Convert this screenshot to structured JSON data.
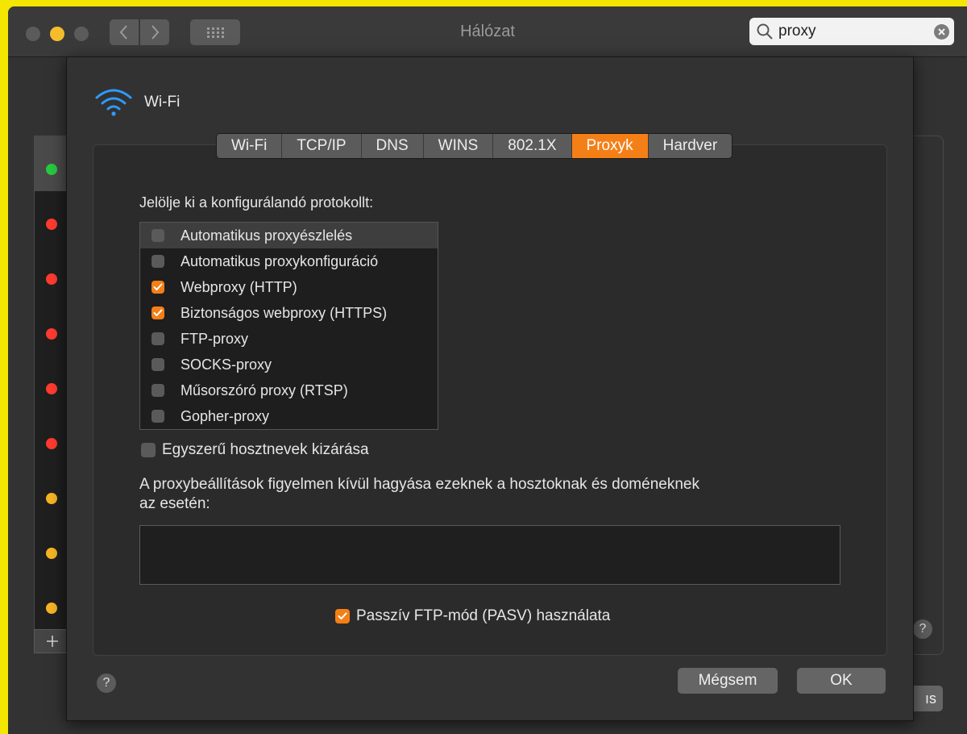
{
  "window": {
    "title": "Hálózat"
  },
  "search": {
    "value": "proxy"
  },
  "sheet": {
    "interface_name": "Wi-Fi",
    "tabs": [
      {
        "label": "Wi-Fi",
        "active": false
      },
      {
        "label": "TCP/IP",
        "active": false
      },
      {
        "label": "DNS",
        "active": false
      },
      {
        "label": "WINS",
        "active": false
      },
      {
        "label": "802.1X",
        "active": false
      },
      {
        "label": "Proxyk",
        "active": true
      },
      {
        "label": "Hardver",
        "active": false
      }
    ],
    "protocols_label": "Jelölje ki a konfigurálandó protokollt:",
    "protocols": [
      {
        "label": "Automatikus proxyészlelés",
        "checked": false,
        "selected": true
      },
      {
        "label": "Automatikus proxykonfiguráció",
        "checked": false,
        "selected": false
      },
      {
        "label": "Webproxy (HTTP)",
        "checked": true,
        "selected": false
      },
      {
        "label": "Biztonságos webproxy (HTTPS)",
        "checked": true,
        "selected": false
      },
      {
        "label": "FTP-proxy",
        "checked": false,
        "selected": false
      },
      {
        "label": "SOCKS-proxy",
        "checked": false,
        "selected": false
      },
      {
        "label": "Műsorszóró proxy (RTSP)",
        "checked": false,
        "selected": false
      },
      {
        "label": "Gopher-proxy",
        "checked": false,
        "selected": false
      }
    ],
    "exclude_simple_hosts": {
      "label": "Egyszerű hosztnevek kizárása",
      "checked": false
    },
    "bypass_label_line1": "A proxybeállítások figyelmen kívül hagyása ezeknek a hosztoknak és doméneknek",
    "bypass_label_line2": "az esetén:",
    "bypass_value": "",
    "pasv": {
      "label": "Passzív FTP-mód (PASV) használata",
      "checked": true
    },
    "cancel_label": "Mégsem",
    "ok_label": "OK",
    "help_label": "?"
  },
  "background": {
    "status_dots": [
      "green",
      "red",
      "red",
      "red",
      "red",
      "red",
      "yellow",
      "yellow",
      "yellow"
    ],
    "help_label": "?",
    "partial_button_label": "ıs"
  },
  "colors": {
    "accent": "#f57f17",
    "green": "#27c93f",
    "red": "#ff3b30",
    "yellow": "#f5b324",
    "wifi_icon": "#2e9bff",
    "desktop": "#f3e600"
  }
}
